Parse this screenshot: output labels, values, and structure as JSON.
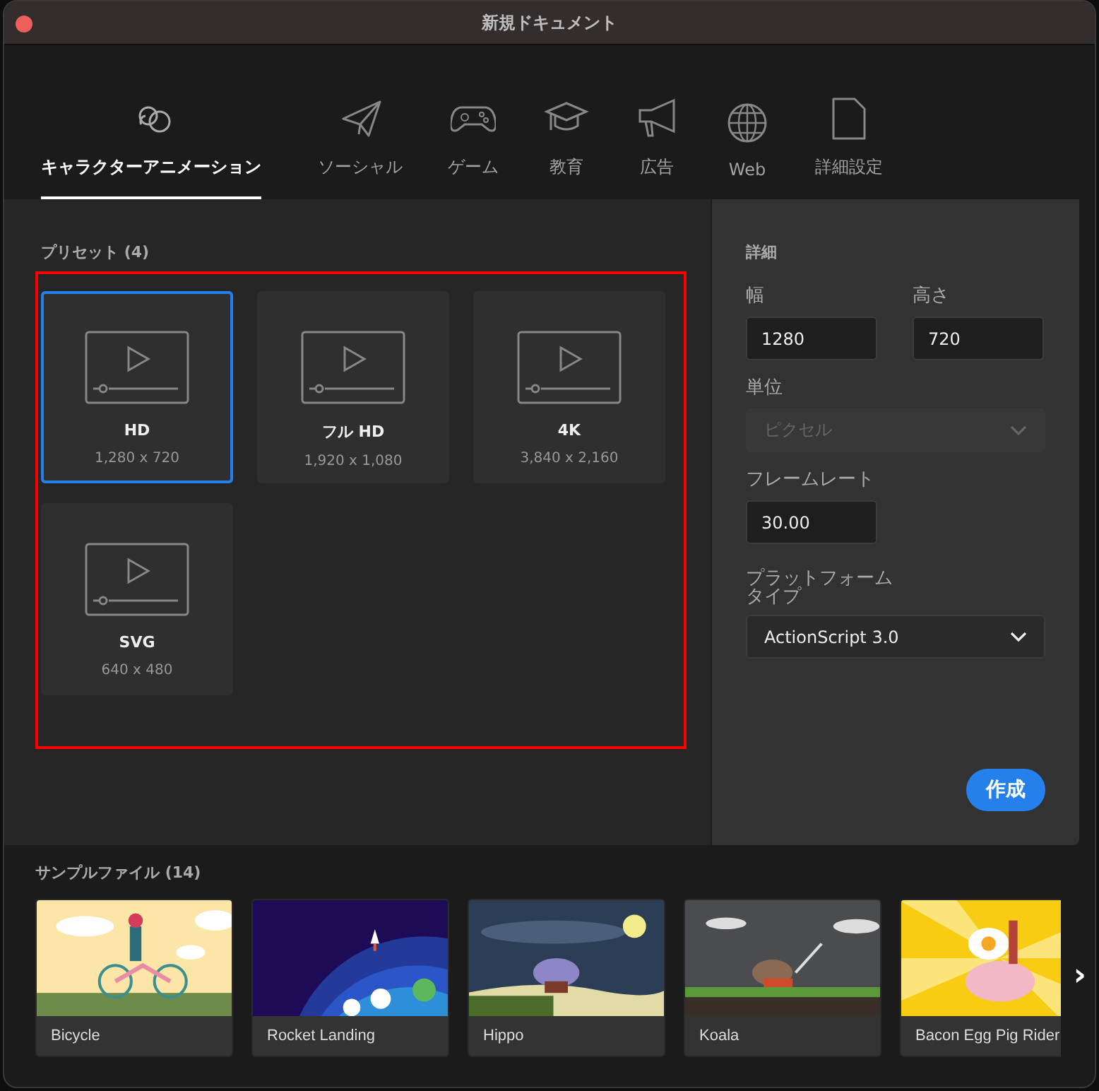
{
  "window": {
    "title": "新規ドキュメント"
  },
  "tabs": [
    {
      "label": "キャラクターアニメーション",
      "selected": true
    },
    {
      "label": "ソーシャル",
      "selected": false
    },
    {
      "label": "ゲーム",
      "selected": false
    },
    {
      "label": "教育",
      "selected": false
    },
    {
      "label": "広告",
      "selected": false
    },
    {
      "label": "Web",
      "selected": false
    },
    {
      "label": "詳細設定",
      "selected": false
    }
  ],
  "presets": {
    "title": "プリセット (4)",
    "items": [
      {
        "name": "HD",
        "size": "1,280 x 720",
        "selected": true
      },
      {
        "name": "フル HD",
        "size": "1,920 x 1,080",
        "selected": false
      },
      {
        "name": "4K",
        "size": "3,840 x 2,160",
        "selected": false
      },
      {
        "name": "SVG",
        "size": "640 x 480",
        "selected": false
      }
    ]
  },
  "details": {
    "title": "詳細",
    "width": {
      "label": "幅",
      "value": "1280"
    },
    "height": {
      "label": "高さ",
      "value": "720"
    },
    "unit": {
      "label": "単位",
      "value": "ピクセル",
      "disabled": true
    },
    "frame_rate": {
      "label": "フレームレート",
      "value": "30.00"
    },
    "platform": {
      "label": "プラットフォームタイプ",
      "value": "ActionScript 3.0",
      "disabled": false
    },
    "create_button": "作成"
  },
  "samples": {
    "title": "サンプルファイル (14)",
    "items": [
      {
        "name": "Bicycle",
        "kind": "picture"
      },
      {
        "name": "Rocket Landing",
        "kind": "picture"
      },
      {
        "name": "Hippo",
        "kind": "picture"
      },
      {
        "name": "Koala",
        "kind": "picture"
      },
      {
        "name": "Bacon Egg Pig Rider",
        "kind": "picture"
      }
    ],
    "next": "›"
  }
}
